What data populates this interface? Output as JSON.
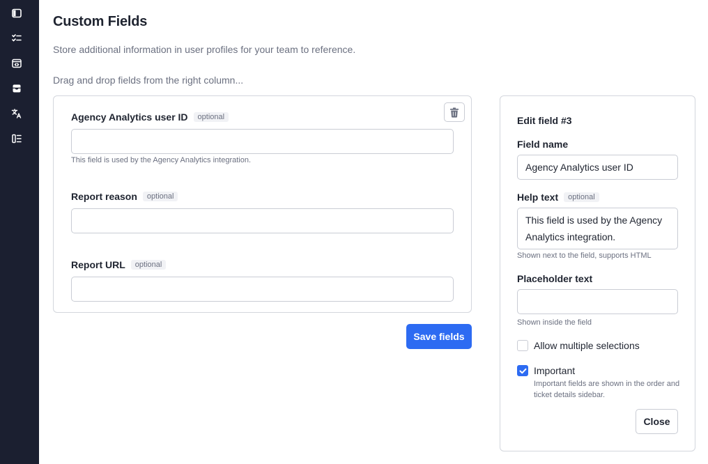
{
  "sidebar": {
    "items": [
      {
        "icon": "sidebar-toggle-icon"
      },
      {
        "icon": "checklist-icon"
      },
      {
        "icon": "code-window-icon"
      },
      {
        "icon": "inbox-icon"
      },
      {
        "icon": "translate-icon"
      },
      {
        "icon": "list-settings-icon"
      }
    ]
  },
  "page": {
    "title": "Custom Fields",
    "subtitle": "Store additional information in user profiles for your team to reference.",
    "hint": "Drag and drop fields from the right column..."
  },
  "fields": [
    {
      "label": "Agency Analytics user ID",
      "badge": "optional",
      "value": "",
      "help": "This field is used by the Agency Analytics integration."
    },
    {
      "label": "Report reason",
      "badge": "optional",
      "value": ""
    },
    {
      "label": "Report URL",
      "badge": "optional",
      "value": ""
    }
  ],
  "actions": {
    "save_label": "Save fields"
  },
  "edit_panel": {
    "title": "Edit field #3",
    "field_name_label": "Field name",
    "field_name_value": "Agency Analytics user ID",
    "help_text_label": "Help text",
    "help_text_badge": "optional",
    "help_text_value": "This field is used by the Agency Analytics integration.",
    "help_text_hint": "Shown next to the field, supports HTML",
    "placeholder_label": "Placeholder text",
    "placeholder_value": "",
    "placeholder_hint": "Shown inside the field",
    "allow_multiple_label": "Allow multiple selections",
    "allow_multiple_checked": false,
    "important_label": "Important",
    "important_checked": true,
    "important_desc": "Important fields are shown in the order and ticket details sidebar.",
    "close_label": "Close"
  },
  "colors": {
    "sidebar_bg": "#1b1f30",
    "accent": "#2d6bf2",
    "muted_text": "#6b7080"
  }
}
